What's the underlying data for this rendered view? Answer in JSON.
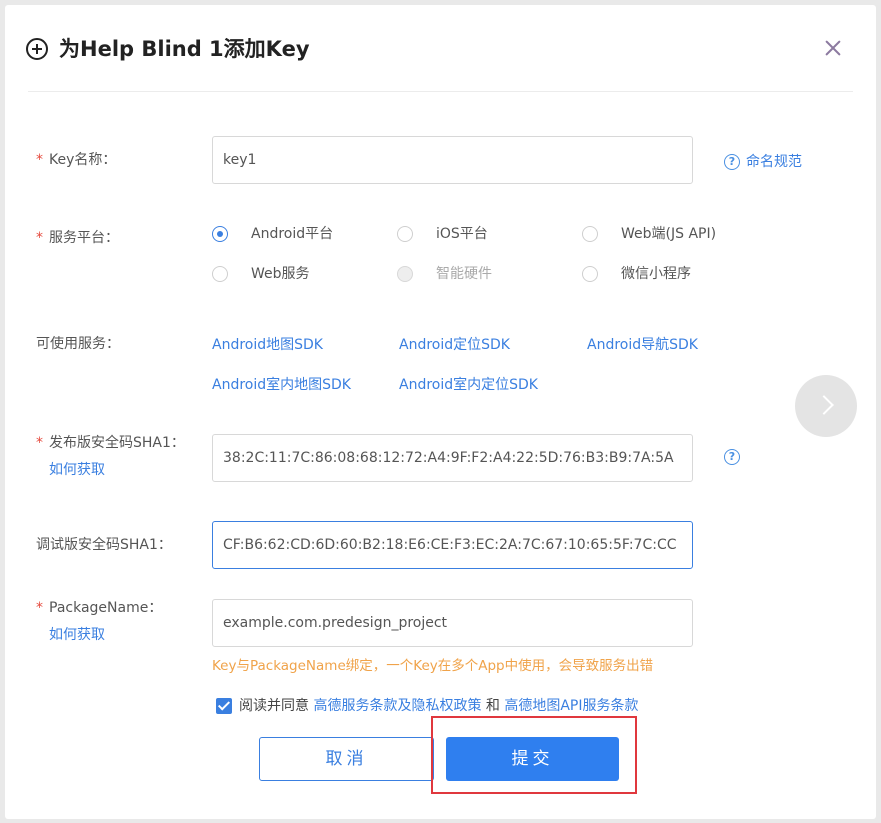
{
  "dialog": {
    "title": "为Help Blind 1添加Key",
    "cancel_label": "取消",
    "submit_label": "提交"
  },
  "form": {
    "key_name": {
      "required_mark": "*",
      "label": "Key名称：",
      "value": "key1",
      "help_link": "命名规范"
    },
    "platform": {
      "required_mark": "*",
      "label": "服务平台：",
      "options": [
        {
          "label": "Android平台",
          "state": "checked"
        },
        {
          "label": "iOS平台",
          "state": "unchecked"
        },
        {
          "label": "Web端(JS API)",
          "state": "unchecked"
        },
        {
          "label": "Web服务",
          "state": "unchecked"
        },
        {
          "label": "智能硬件",
          "state": "disabled"
        },
        {
          "label": "微信小程序",
          "state": "unchecked"
        }
      ]
    },
    "services": {
      "label": "可使用服务：",
      "items": [
        "Android地图SDK",
        "Android定位SDK",
        "Android导航SDK",
        "Android室内地图SDK",
        "Android室内定位SDK"
      ]
    },
    "release_sha1": {
      "required_mark": "*",
      "label": "发布版安全码SHA1：",
      "how_link": "如何获取",
      "value": "38:2C:11:7C:86:08:68:12:72:A4:9F:F2:A4:22:5D:76:B3:B9:7A:5A",
      "help_glyph": "?"
    },
    "debug_sha1": {
      "label": "调试版安全码SHA1：",
      "value": "CF:B6:62:CD:6D:60:B2:18:E6:CE:F3:EC:2A:7C:67:10:65:5F:7C:CC"
    },
    "package_name": {
      "required_mark": "*",
      "label": "PackageName：",
      "how_link": "如何获取",
      "value": "example.com.predesign_project",
      "warning": "Key与PackageName绑定，一个Key在多个App中使用，会导致服务出错"
    },
    "agreement": {
      "checked": true,
      "prefix": "阅读并同意",
      "link1": "高德服务条款及隐私权政策",
      "conjunction": "和",
      "link2": "高德地图API服务条款"
    }
  },
  "colors": {
    "accent": "#3a7fe0",
    "required": "#e5493d",
    "warning": "#f0a34a",
    "highlight": "#e0383e"
  }
}
